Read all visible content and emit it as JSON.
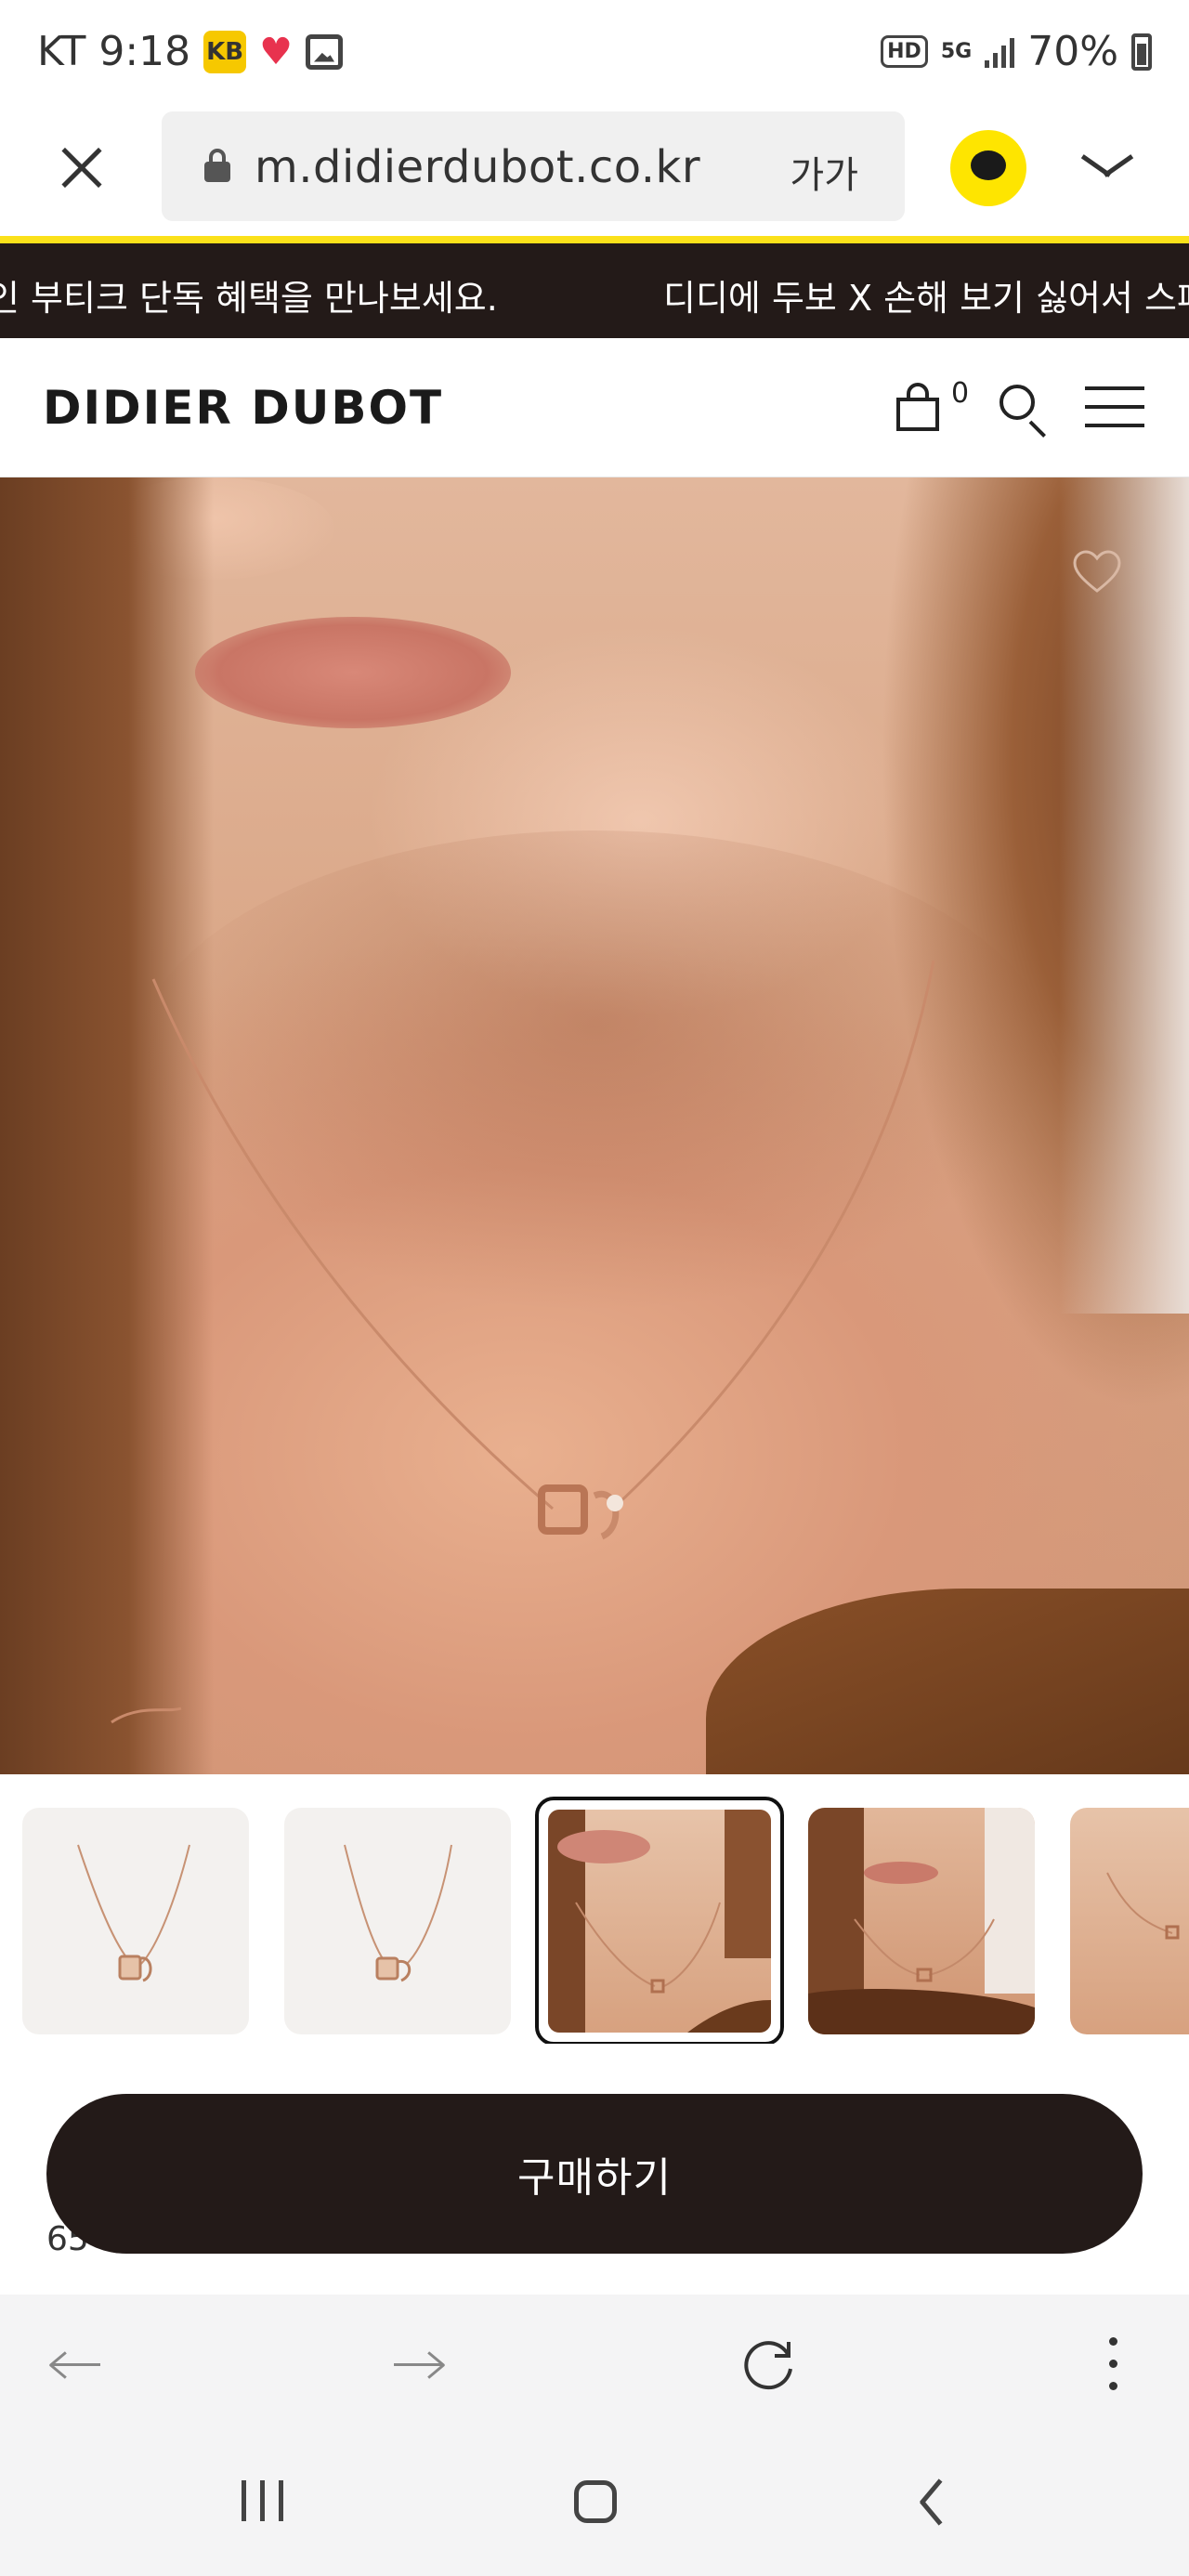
{
  "status_bar": {
    "carrier": "KT",
    "time": "9:18",
    "kb_badge": "KB",
    "network_hd": "HD",
    "network_type": "5G",
    "battery": "70%"
  },
  "browser": {
    "url": "m.didierdubot.co.kr",
    "text_size": "가가"
  },
  "marquee": {
    "text_left": "인 부티크 단독 혜택을 만나보세요.",
    "text_right": "디디에 두보 X 손해 보기 싫어서 스페셜"
  },
  "header": {
    "logo": "DIDIER DUBOT",
    "cart_count": "0"
  },
  "thumbnails": {
    "count": 5,
    "selected_index": 2,
    "items": [
      "product-front",
      "product-angle",
      "model-closeup",
      "model-wide",
      "model-partial"
    ]
  },
  "buy": {
    "label": "구매하기",
    "price_peek": "65"
  },
  "icons": {
    "close": "close-icon",
    "lock": "lock-icon",
    "kakao": "kakao-chat-icon",
    "cart": "cart-icon",
    "search": "search-icon",
    "menu": "menu-icon",
    "wishlist": "heart-outline-icon"
  },
  "colors": {
    "accent_yellow": "#fbe11a",
    "dark_brand": "#231a18",
    "kakao_yellow": "#fee500"
  }
}
